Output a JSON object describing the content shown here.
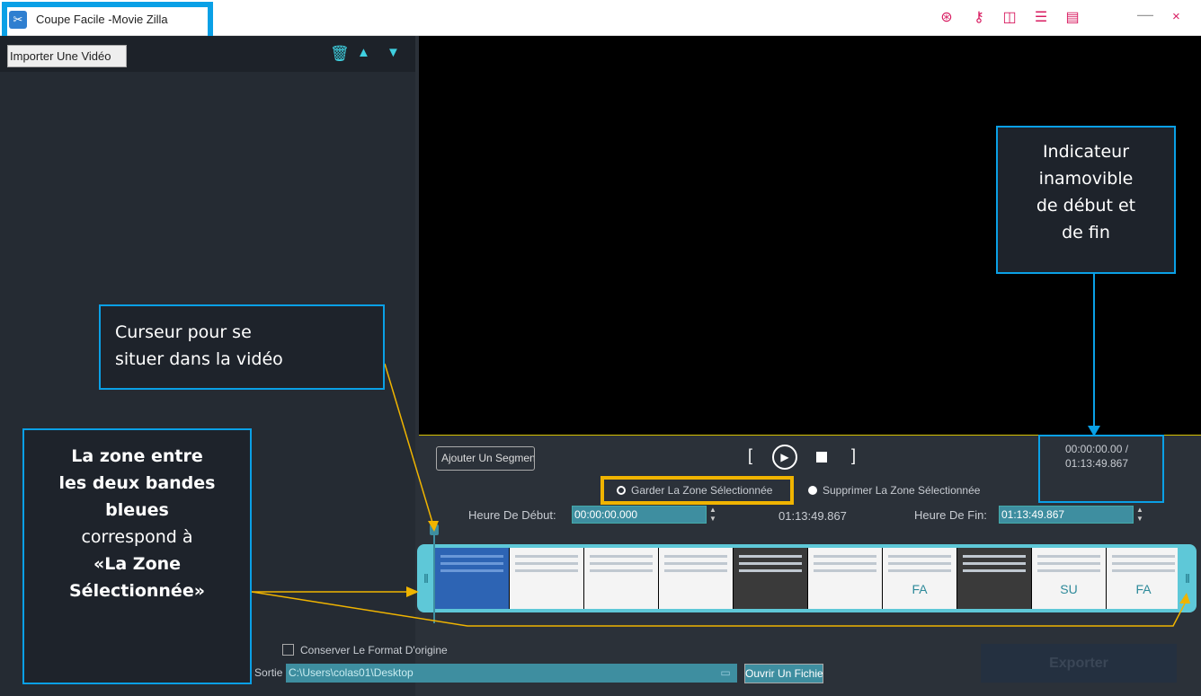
{
  "window": {
    "title": "Coupe Facile -Movie Zilla",
    "minimize": "—",
    "close": "×"
  },
  "titlebar_icons": [
    "cart-icon",
    "key-icon",
    "layout-icon",
    "list-settings-icon",
    "menu-icon"
  ],
  "left": {
    "import_label": "Importer Une Vidéo"
  },
  "player": {
    "add_segment_label": "Ajouter Un Segment",
    "bracket_open": "[",
    "bracket_close": "]",
    "current_time": "00:00:00.00 /",
    "total_time": "01:13:49.867"
  },
  "mode": {
    "keep_label": "Garder La Zone Sélectionnée",
    "remove_label": "Supprimer La Zone Sélectionnée",
    "selected": "keep"
  },
  "range": {
    "start_label": "Heure De Début:",
    "start_value": "00:00:00.000",
    "duration": "01:13:49.867",
    "end_label": "Heure De Fin:",
    "end_value": "01:13:49.867"
  },
  "timeline": {
    "frames": [
      {
        "style": "blue",
        "text": ""
      },
      {
        "style": "white",
        "text": ""
      },
      {
        "style": "white",
        "text": ""
      },
      {
        "style": "white",
        "text": ""
      },
      {
        "style": "dark",
        "text": ""
      },
      {
        "style": "white",
        "text": ""
      },
      {
        "style": "white",
        "text": "FA"
      },
      {
        "style": "dark",
        "text": ""
      },
      {
        "style": "white",
        "text": "SU"
      },
      {
        "style": "white",
        "text": "FA"
      }
    ]
  },
  "output": {
    "keep_format_label": "Conserver Le Format D'origine",
    "keep_format_checked": false,
    "dir_label": "Répertoire De Sortie",
    "dir_value": "C:\\Users\\colas01\\Desktop",
    "open_file_label": "Ouvrir Un Fichier",
    "export_label": "Exporter"
  },
  "annotations": {
    "top_right": [
      "Indicateur",
      "inamovible",
      "de début et",
      "de fin"
    ],
    "cursor": [
      "Curseur pour se",
      "situer dans la vidéo"
    ],
    "zone": {
      "line1": "La zone entre",
      "line2": "les deux bandes",
      "line3": "bleues",
      "line4": "correspond à",
      "line5": "«La Zone",
      "line6": "Sélectionnée»"
    }
  },
  "colors": {
    "accent": "#3e8ea0",
    "highlight_blue": "#0aa0e6",
    "highlight_yellow": "#f0b400",
    "brand_pink": "#d81b60"
  }
}
